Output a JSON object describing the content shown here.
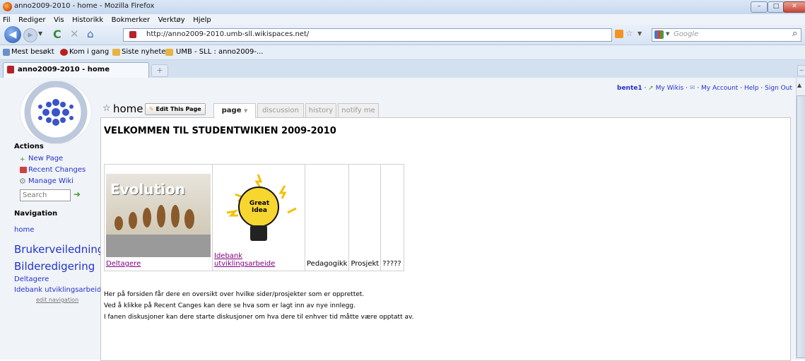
{
  "window": {
    "title": "anno2009-2010 - home - Mozilla Firefox",
    "minimize": "–",
    "maximize": "□",
    "close": "✕"
  },
  "menubar": {
    "items": [
      "Fil",
      "Rediger",
      "Vis",
      "Historikk",
      "Bokmerker",
      "Verktøy",
      "Hjelp"
    ]
  },
  "toolbar": {
    "url": "http://anno2009-2010.umb-sll.wikispaces.net/",
    "search_placeholder": "Google"
  },
  "bookmarks": {
    "items": [
      "Mest besøkt",
      "Kom i gang",
      "Siste nyheter",
      "UMB - SLL : anno2009-..."
    ]
  },
  "tab": {
    "title": "anno2009-2010 - home",
    "new_tab": "+"
  },
  "topnav": {
    "user": "bente1",
    "my_wikis": "My Wikis",
    "my_account": "My Account",
    "help": "Help",
    "sign_out": "Sign Out",
    "sep": "·"
  },
  "sidebar": {
    "actions_heading": "Actions",
    "new_page": "New Page",
    "recent_changes": "Recent Changes",
    "manage_wiki": "Manage Wiki",
    "search_placeholder": "Search",
    "navigation_heading": "Navigation",
    "nav_home": "home",
    "nav_brukerveiledning": "Brukerveiledning",
    "nav_bilderedigering": "Bilderedigering",
    "nav_deltagere": "Deltagere",
    "nav_idebank": "Idebank utviklingsarbeide",
    "edit_navigation": "edit navigation"
  },
  "page": {
    "title": "home",
    "edit_button": "Edit This Page",
    "tabs": [
      "page",
      "discussion",
      "history",
      "notify me"
    ],
    "heading": "VELKOMMEN TIL STUDENTWIKIEN 2009-2010",
    "table": {
      "cells": [
        "Deltagere",
        "Idebank utviklingsarbeide",
        "Pedagogikk",
        "Prosjekt",
        "?????"
      ]
    },
    "body": [
      "Her på forsiden får dere en oversikt over hvilke sider/prosjekter som er opprettet.",
      "Ved å klikke på Recent Canges kan dere se hva som er lagt inn av nye innlegg.",
      "I fanen diskusjoner kan dere starte diskusjoner om hva dere til enhver tid måtte være opptatt av."
    ],
    "image1_text": "Evolution",
    "image2_text": "Great Idea"
  },
  "colors": {
    "link": "#2233cc",
    "visited": "#800080",
    "accent": "#3a7bd5"
  }
}
